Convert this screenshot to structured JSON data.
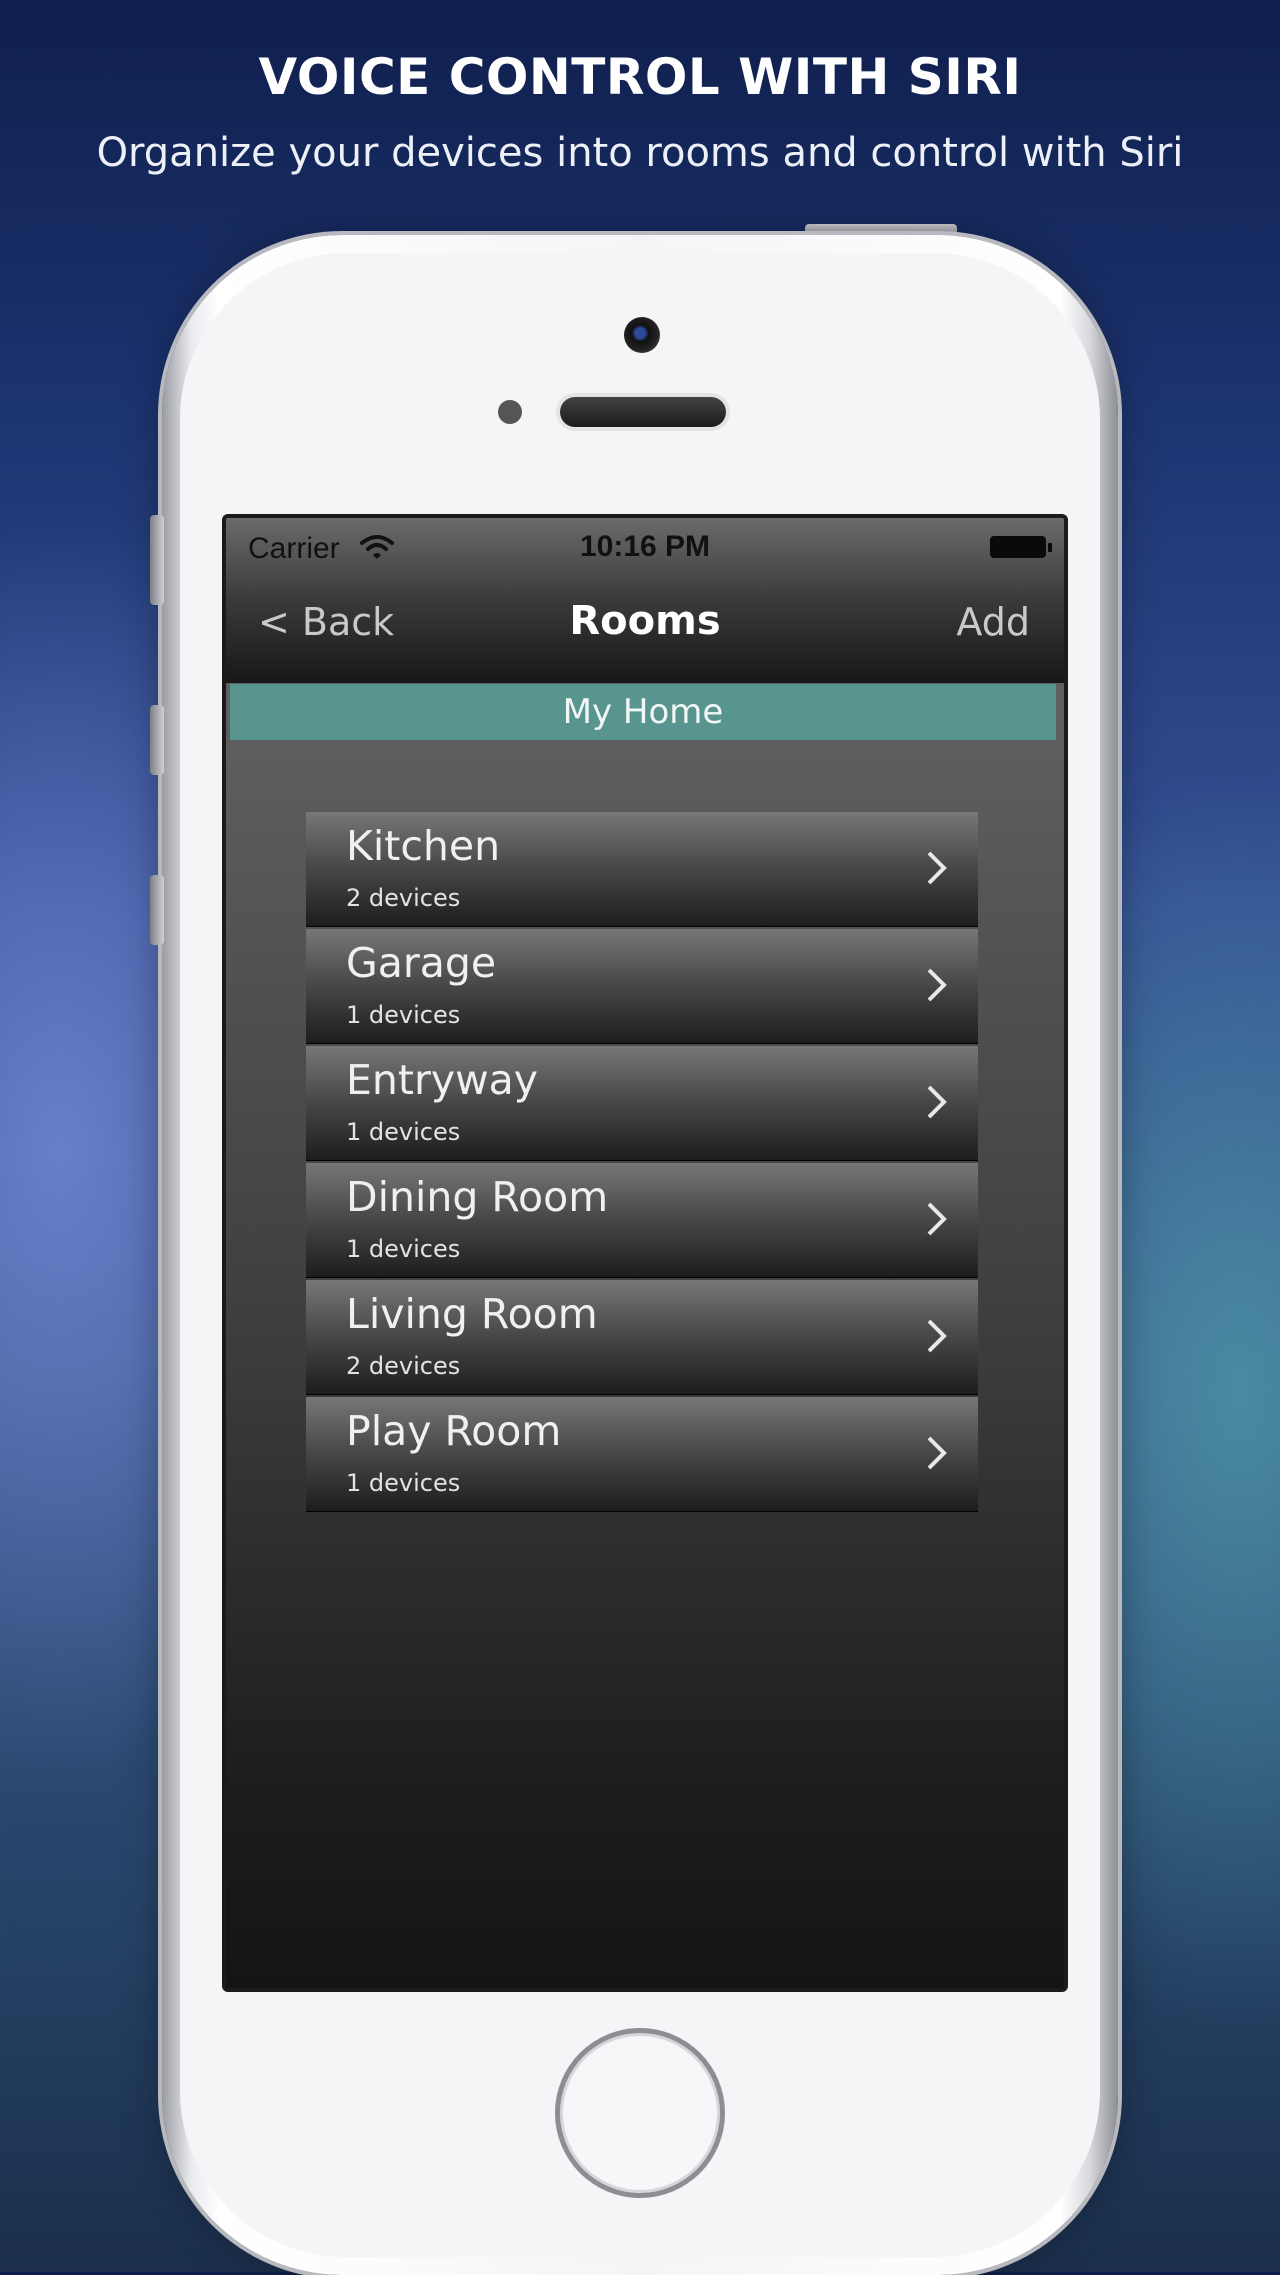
{
  "promo": {
    "title": "VOICE CONTROL WITH SIRI",
    "subtitle": "Organize your devices into rooms and control with Siri"
  },
  "status_bar": {
    "carrier": "Carrier",
    "time": "10:16 PM",
    "icons": [
      "wifi-icon",
      "battery-icon"
    ]
  },
  "nav": {
    "back_label": "< Back",
    "title": "Rooms",
    "add_label": "Add"
  },
  "home": {
    "name": "My Home",
    "color": "#58958f"
  },
  "rooms": [
    {
      "name": "Kitchen",
      "devices": "2 devices"
    },
    {
      "name": "Garage",
      "devices": "1 devices"
    },
    {
      "name": "Entryway",
      "devices": "1 devices"
    },
    {
      "name": "Dining Room",
      "devices": "1 devices"
    },
    {
      "name": "Living Room",
      "devices": "2 devices"
    },
    {
      "name": "Play Room",
      "devices": "1 devices"
    }
  ]
}
